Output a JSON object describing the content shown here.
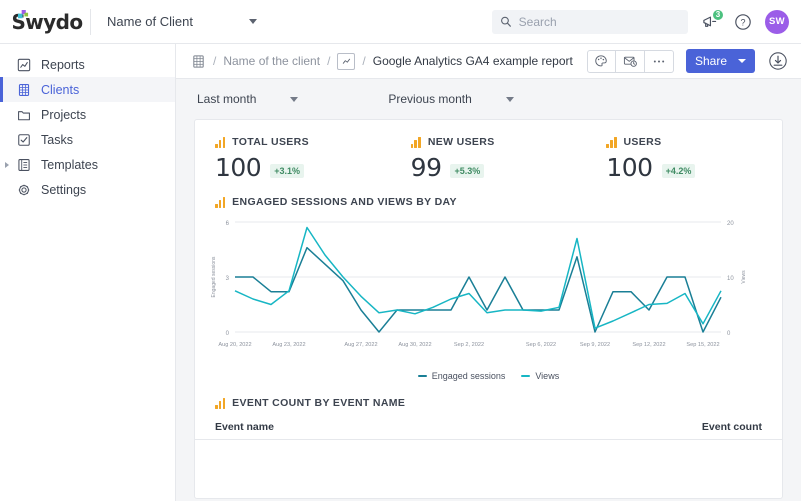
{
  "topbar": {
    "logo": "Swydo",
    "client_selector": "Name of Client",
    "search": {
      "placeholder": "Search",
      "value": ""
    },
    "announcements_badge": "3",
    "help_label": "?",
    "avatar_initials": "SW"
  },
  "sidebar": {
    "items": [
      {
        "label": "Reports",
        "icon": "chart-icon",
        "active": false,
        "expandable": false
      },
      {
        "label": "Clients",
        "icon": "building-icon",
        "active": true,
        "expandable": false
      },
      {
        "label": "Projects",
        "icon": "folder-icon",
        "active": false,
        "expandable": false
      },
      {
        "label": "Tasks",
        "icon": "checkbox-icon",
        "active": false,
        "expandable": false
      },
      {
        "label": "Templates",
        "icon": "document-icon",
        "active": false,
        "expandable": true
      },
      {
        "label": "Settings",
        "icon": "gear-icon",
        "active": false,
        "expandable": false
      }
    ]
  },
  "breadcrumb": {
    "sep": "/",
    "client": "Name of the client",
    "report": "Google Analytics GA4 example report"
  },
  "toolbar": {
    "palette_tooltip": "Theme",
    "schedule_tooltip": "Schedule email",
    "more_label": "•••",
    "share_label": "Share",
    "download_tooltip": "Download"
  },
  "filters": {
    "period": "Last month",
    "compare": "Previous month"
  },
  "kpis": [
    {
      "title": "TOTAL USERS",
      "value": "100",
      "delta": "+3.1%"
    },
    {
      "title": "NEW USERS",
      "value": "99",
      "delta": "+5.3%"
    },
    {
      "title": "USERS",
      "value": "100",
      "delta": "+4.2%"
    }
  ],
  "chart_section": {
    "title": "ENGAGED SESSIONS AND VIEWS BY DAY"
  },
  "events_section": {
    "title": "EVENT COUNT BY EVENT NAME",
    "columns": [
      "Event name",
      "Event count"
    ],
    "rows": []
  },
  "colors": {
    "accent": "#4a63d8",
    "engaged_sessions": "#1a7f96",
    "views": "#17b6c4",
    "positive": "#3f8b63",
    "ga_orange": "#f2a625",
    "avatar": "#9b5de8",
    "badge_green": "#4cc17f"
  },
  "chart_data": {
    "type": "line",
    "title": "Engaged sessions and views by day",
    "xlabel": "",
    "ylabel": "Engaged sessions",
    "y2label": "Views",
    "ylim": [
      0,
      6
    ],
    "y2lim": [
      0,
      20
    ],
    "yticks": [
      0,
      3,
      6
    ],
    "y2ticks": [
      0,
      10,
      20
    ],
    "grid": true,
    "legend_position": "bottom",
    "x": [
      "Aug 20, 2022",
      "Aug 21, 2022",
      "Aug 22, 2022",
      "Aug 23, 2022",
      "Aug 24, 2022",
      "Aug 25, 2022",
      "Aug 26, 2022",
      "Aug 27, 2022",
      "Aug 28, 2022",
      "Aug 29, 2022",
      "Aug 30, 2022",
      "Aug 31, 2022",
      "Sep 1, 2022",
      "Sep 2, 2022",
      "Sep 3, 2022",
      "Sep 4, 2022",
      "Sep 5, 2022",
      "Sep 6, 2022",
      "Sep 7, 2022",
      "Sep 8, 2022",
      "Sep 9, 2022",
      "Sep 10, 2022",
      "Sep 11, 2022",
      "Sep 12, 2022",
      "Sep 13, 2022",
      "Sep 14, 2022",
      "Sep 15, 2022",
      "Sep 16, 2022"
    ],
    "xtick_labels": [
      "Aug 20, 2022",
      "Aug 23, 2022",
      "Aug 27, 2022",
      "Aug 30, 2022",
      "Sep 2, 2022",
      "Sep 6, 2022",
      "Sep 9, 2022",
      "Sep 12, 2022",
      "Sep 15, 2022"
    ],
    "xtick_indices": [
      0,
      3,
      7,
      10,
      13,
      17,
      20,
      23,
      26
    ],
    "series": [
      {
        "name": "Engaged sessions",
        "color": "#1a7f96",
        "axis": "left",
        "values": [
          3,
          3,
          2.2,
          2.2,
          4.6,
          3.7,
          2.8,
          1.2,
          0,
          1.2,
          1.2,
          1.2,
          1.2,
          3,
          1.2,
          3,
          1.2,
          1.2,
          1.2,
          4.1,
          0,
          2.2,
          2.2,
          1.2,
          3,
          3,
          0,
          1.9
        ]
      },
      {
        "name": "Views",
        "color": "#17b6c4",
        "axis": "right",
        "values": [
          7.5,
          6,
          5,
          7.5,
          19,
          14,
          10,
          6.5,
          3.5,
          4,
          3.3,
          4.5,
          6,
          7,
          3.5,
          4,
          4,
          3.8,
          4.5,
          17,
          0.7,
          2,
          3.5,
          5,
          5.2,
          7,
          1.5,
          7.5
        ]
      }
    ]
  }
}
